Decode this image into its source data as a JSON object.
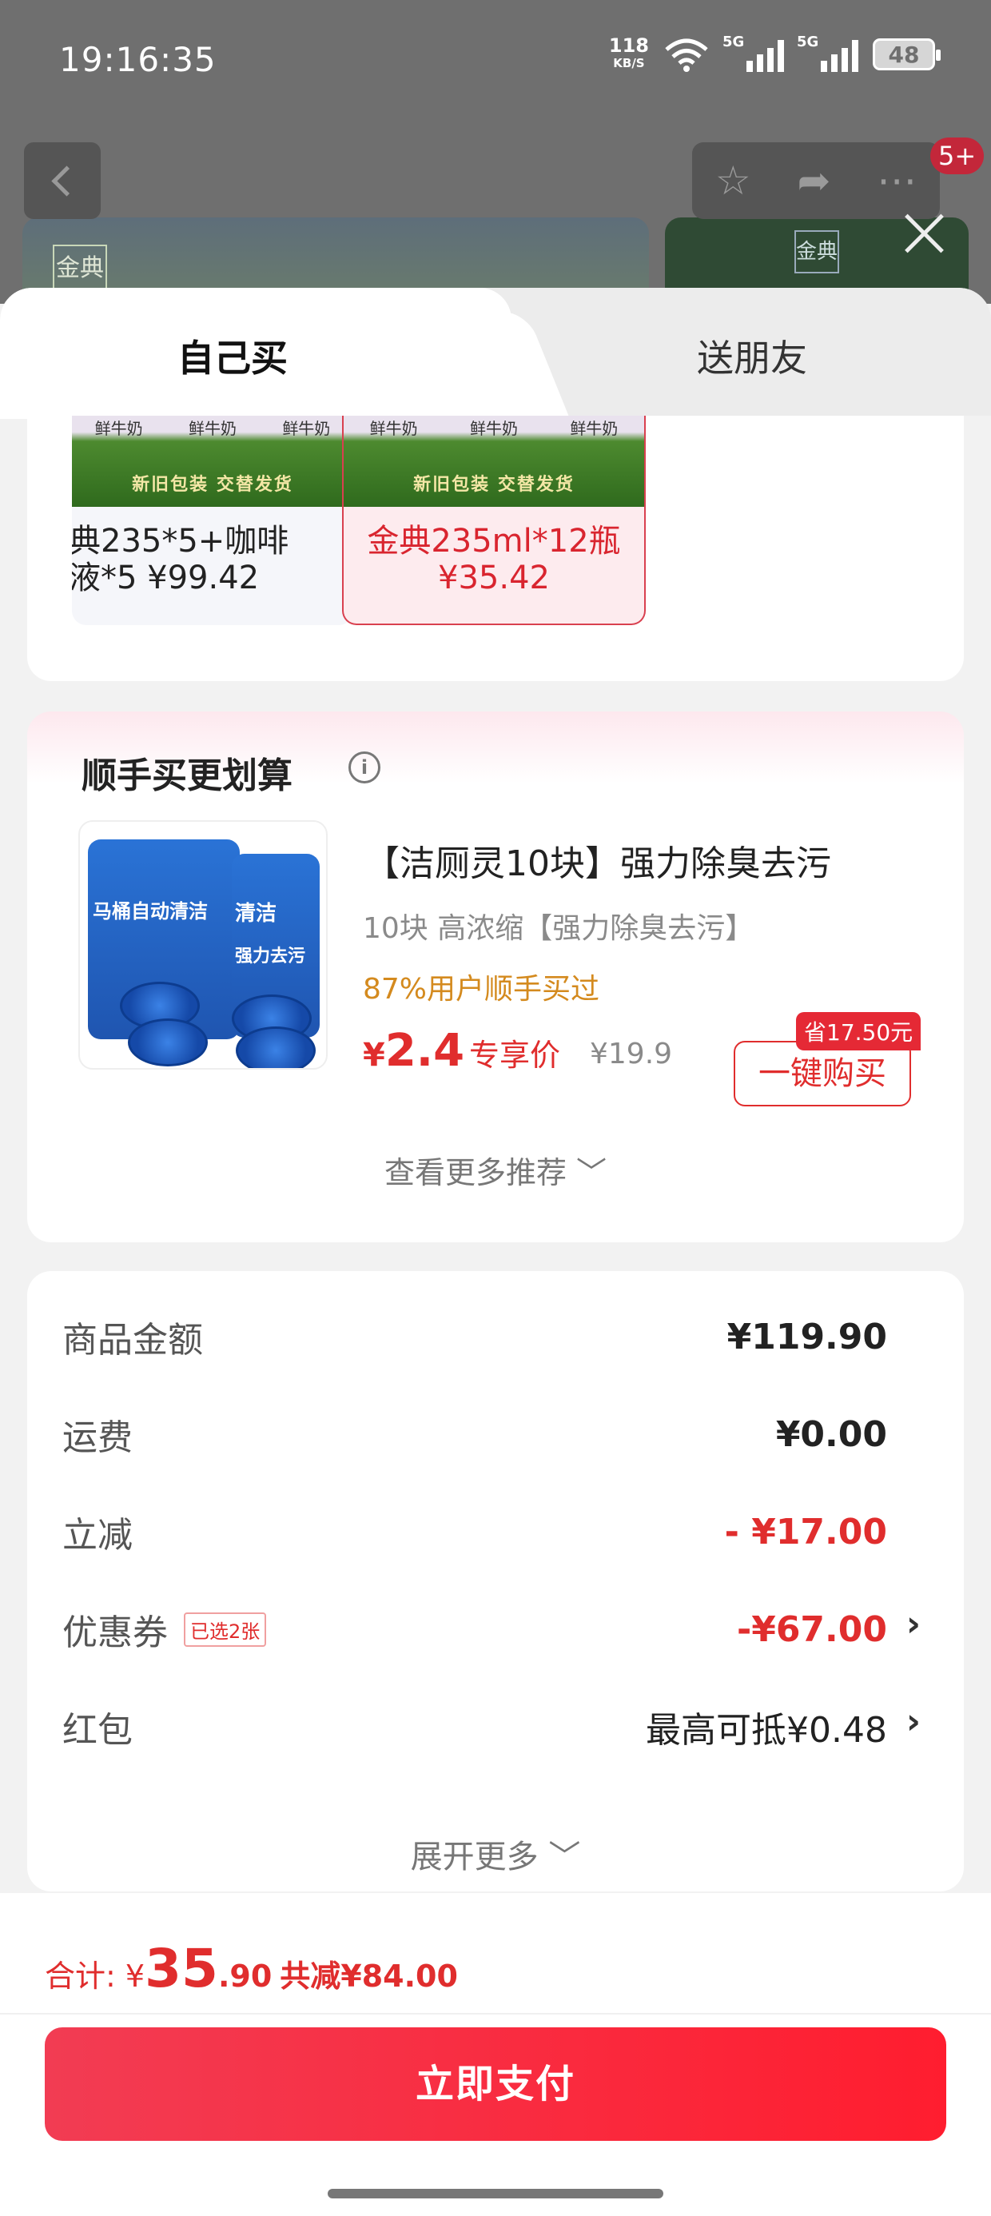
{
  "status_bar": {
    "time": "19:16:35",
    "net_speed": "118",
    "net_unit": "KB/S",
    "signal1": "5G",
    "signal2": "5G",
    "battery": "48"
  },
  "background": {
    "badge": "5+",
    "logo_text": "金典"
  },
  "tabs": {
    "self": "自己买",
    "gift": "送朋友"
  },
  "options": [
    {
      "label_line1": "典235*5+咖啡",
      "label_line2": "液*5 ¥99.42",
      "tagline": "新旧包装 交替发货",
      "bottle_text": "鲜牛奶"
    },
    {
      "label_line1": "金典235ml*12瓶",
      "label_line2": "¥35.42",
      "tagline": "新旧包装 交替发货",
      "bottle_text": "鲜牛奶"
    }
  ],
  "buy_together": {
    "title": "顺手买更划算",
    "info_icon": "i",
    "product_name": "【洁厕灵10块】强力除臭去污",
    "spec": "10块 高浓缩【强力除臭去污】",
    "hint": "87%用户顺手买过",
    "currency": "¥",
    "price_big": "2.4",
    "price_label": "专享价",
    "orig_price": "¥19.9",
    "save_tag": "省17.50元",
    "buy_button": "一键购买",
    "more": "查看更多推荐 ﹀",
    "pack_text1": "马桶自动清洁",
    "pack_text2": "清洁",
    "pack_text3": "强力去污"
  },
  "summary": {
    "goods_label": "商品金额",
    "goods_value": "¥119.90",
    "shipping_label": "运费",
    "shipping_value": "¥0.00",
    "discount_label": "立减",
    "discount_value": "- ¥17.00",
    "coupon_label": "优惠券",
    "coupon_tag": "已选2张",
    "coupon_value": "-¥67.00",
    "redpacket_label": "红包",
    "redpacket_value": "最高可抵¥0.48",
    "expand": "展开更多 ﹀"
  },
  "footer": {
    "total_label": "合计: ",
    "currency": "¥",
    "total_big": "35",
    "total_dec": ".90",
    "reduce": "共减¥84.00",
    "pay_button": "立即支付"
  }
}
